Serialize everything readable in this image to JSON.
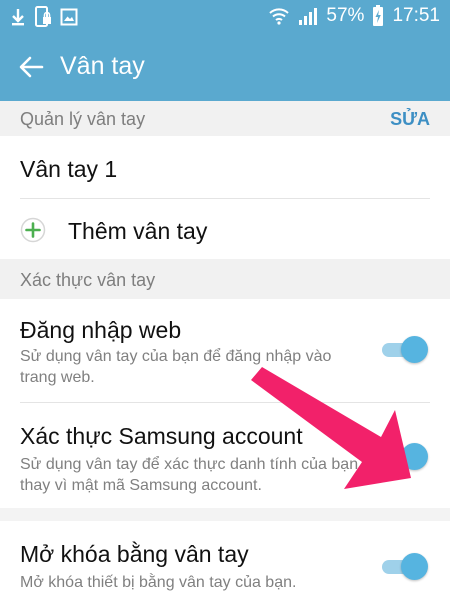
{
  "status_bar": {
    "battery": "57%",
    "time": "17:51",
    "icons_left": [
      "download-icon",
      "phone-lock-icon",
      "image-icon"
    ],
    "icons_right": [
      "wifi-icon",
      "signal-icon",
      "battery-icon"
    ]
  },
  "app_bar": {
    "title": "Vân tay"
  },
  "section_manage": {
    "label": "Quản lý vân tay",
    "edit": "SỬA"
  },
  "fingerprint_item": {
    "label": "Vân tay 1"
  },
  "add_fingerprint": {
    "label": "Thêm vân tay"
  },
  "section_verify": {
    "label": "Xác thực vân tay"
  },
  "web_signin": {
    "title": "Đăng nhập web",
    "description": "Sử dụng vân tay của bạn để đăng nhập vào trang web.",
    "enabled": true
  },
  "samsung_account": {
    "title": "Xác thực Samsung account",
    "description": "Sử dụng vân tay để xác thực danh tính của bạn thay vì mật mã Samsung account.",
    "enabled": true
  },
  "unlock": {
    "title": "Mở khóa bằng vân tay",
    "description": "Mở khóa thiết bị bằng vân tay của bạn.",
    "enabled": true
  },
  "colors": {
    "primary": "#5aa9cf",
    "accent": "#3d8fc4",
    "toggle_on": "#56b4e0",
    "annotation_arrow": "#f2216a"
  }
}
